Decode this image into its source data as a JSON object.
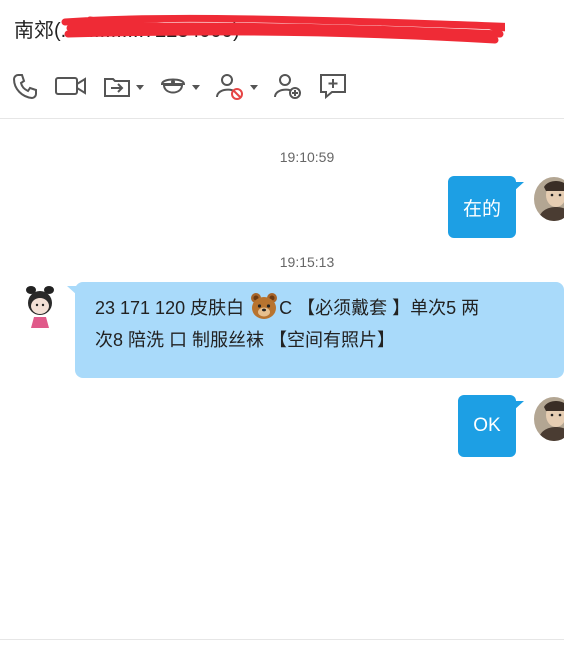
{
  "header": {
    "title_prefix": "南郊",
    "title_rest": "(...............72234999)",
    "toolbar": [
      {
        "icon": "phone-icon"
      },
      {
        "icon": "video-call-icon"
      },
      {
        "icon": "file-transfer-icon",
        "dropdown": true
      },
      {
        "icon": "remote-assist-icon",
        "dropdown": true
      },
      {
        "icon": "block-user-icon",
        "dropdown": true
      },
      {
        "icon": "add-friend-icon"
      },
      {
        "icon": "new-message-icon"
      }
    ]
  },
  "colors": {
    "outgoing_bubble": "#1d9fe4",
    "incoming_bubble": "#a9dafa",
    "redaction": "#ef2b36"
  },
  "messages": [
    {
      "time": "19:10:59",
      "direction": "out",
      "text": "在的"
    },
    {
      "time": "19:15:13",
      "direction": "in",
      "line1_before": "23 171 120 皮肤白 ",
      "line1_after": "C 【必须戴套 】单次5 两",
      "line2": "次8 陪洗 口 制服丝袜 【空间有照片】"
    },
    {
      "time": "",
      "direction": "out",
      "text": "OK"
    }
  ]
}
